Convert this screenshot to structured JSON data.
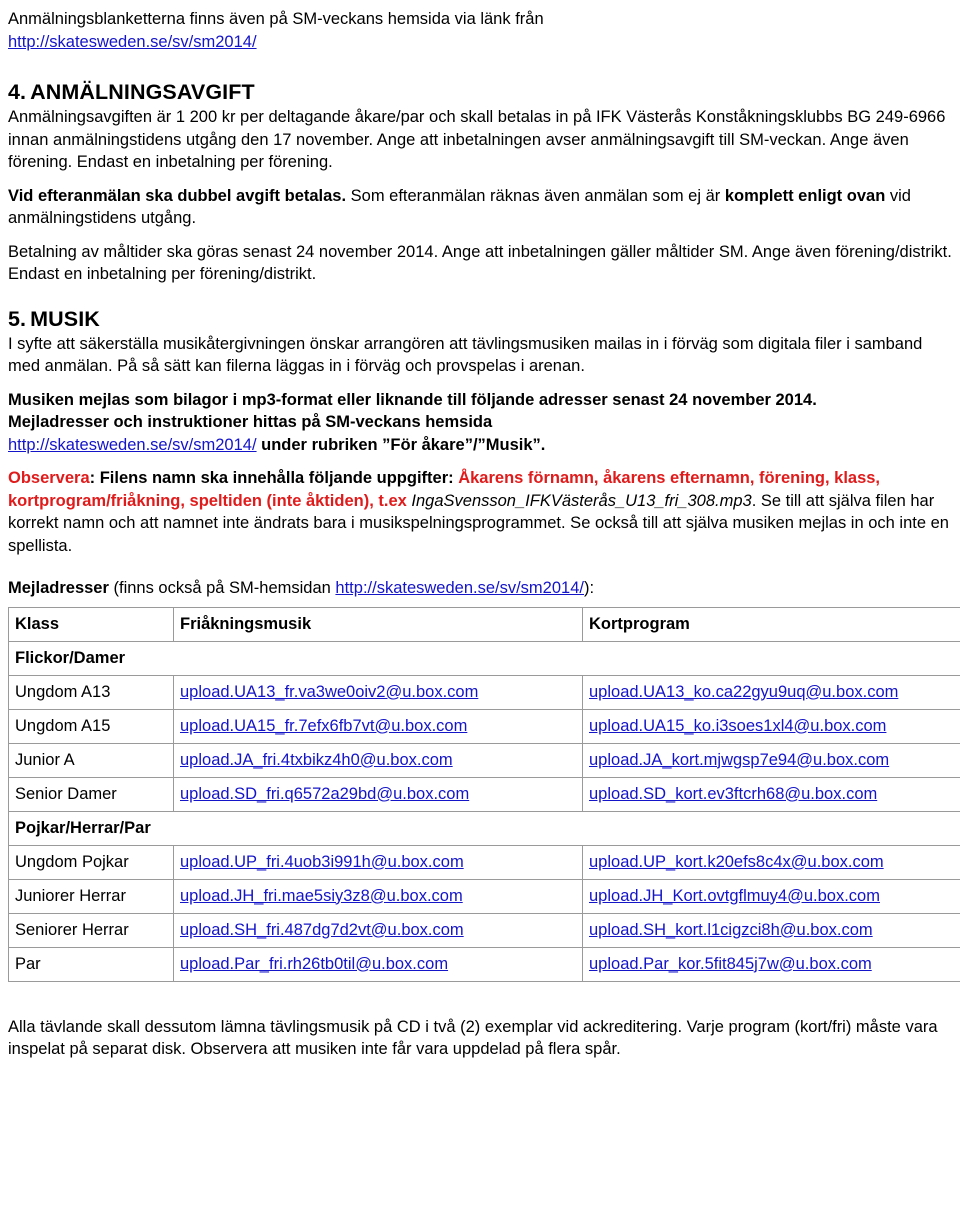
{
  "document": {
    "intro": {
      "line1": "Anmälningsblanketterna finns även på SM-veckans hemsida via länk från",
      "link": "http://skatesweden.se/sv/sm2014/"
    },
    "section4": {
      "number": "4.",
      "title": "ANMÄLNINGSAVGIFT",
      "p1": "Anmälningsavgiften är 1 200 kr per deltagande åkare/par och skall betalas in på IFK Västerås Konståkningsklubbs BG 249-6966 innan anmälningstidens utgång den 17 november. Ange att inbetalningen avser anmälningsavgift till SM-veckan. Ange även förening. Endast en inbetalning per förening.",
      "p2_bold1": "Vid efteranmälan ska dubbel avgift betalas.",
      "p2_mid": " Som efteranmälan räknas även anmälan som ej är ",
      "p2_bold2": "komplett enligt ovan",
      "p2_end": " vid anmälningstidens utgång.",
      "p3": "Betalning av måltider ska göras senast 24 november 2014. Ange att inbetalningen gäller måltider SM. Ange även förening/distrikt. Endast en inbetalning per förening/distrikt."
    },
    "section5": {
      "number": "5.",
      "title": "MUSIK",
      "p1": "I syfte att säkerställa musikåtergivningen önskar arrangören att tävlingsmusiken mailas in i förväg som digitala filer i samband med anmälan. På så sätt kan filerna läggas in i förväg och provspelas i arenan.",
      "p2_bold": "Musiken mejlas som bilagor i mp3-format eller liknande till följande adresser senast 24 november 2014.",
      "p3_bold": "Mejladresser och instruktioner hittas på SM-veckans hemsida",
      "p3_link": "http://skatesweden.se/sv/sm2014/",
      "p3_after_bold": " under rubriken ”För åkare”/”Musik”.",
      "observera_label": "Observera",
      "observera_black1": ": Filens namn ska innehålla följande uppgifter: ",
      "observera_red": "Åkarens förnamn, åkarens efternamn, förening, klass, kortprogram/friåkning, speltiden (inte åktiden), t.ex",
      "observera_italic": "IngaSvensson_IFKVästerås_U13_fri_308.mp3",
      "observera_black2": ". Se till att själva filen har korrekt namn och att namnet inte ändrats bara i musikspelningsprogrammet. Se också till att själva musiken mejlas in och inte en spellista."
    },
    "mail_note": {
      "bold": "Mejladresser",
      "mid": " (finns också på SM-hemsidan ",
      "link": "http://skatesweden.se/sv/sm2014/",
      "end": "):"
    },
    "table": {
      "headers": [
        "Klass",
        "Friåkningsmusik",
        "Kortprogram"
      ],
      "rows": [
        {
          "type": "group",
          "label": "Flickor/Damer"
        },
        {
          "type": "data",
          "klass": "Ungdom A13",
          "fri": "upload.UA13_fr.va3we0oiv2@u.box.com",
          "kort": "upload.UA13_ko.ca22gyu9uq@u.box.com"
        },
        {
          "type": "data",
          "klass": "Ungdom A15",
          "fri": "upload.UA15_fr.7efx6fb7vt@u.box.com",
          "kort": "upload.UA15_ko.i3soes1xl4@u.box.com"
        },
        {
          "type": "data",
          "klass": "Junior A",
          "fri": "upload.JA_fri.4txbikz4h0@u.box.com",
          "kort": "upload.JA_kort.mjwgsp7e94@u.box.com"
        },
        {
          "type": "data",
          "klass": "Senior Damer",
          "fri": "upload.SD_fri.q6572a29bd@u.box.com",
          "kort": "upload.SD_kort.ev3ftcrh68@u.box.com"
        },
        {
          "type": "group",
          "label": "Pojkar/Herrar/Par"
        },
        {
          "type": "data",
          "klass": "Ungdom Pojkar",
          "fri": "upload.UP_fri.4uob3i991h@u.box.com",
          "kort": "upload.UP_kort.k20efs8c4x@u.box.com"
        },
        {
          "type": "data",
          "klass": "Juniorer Herrar",
          "fri": "upload.JH_fri.mae5siy3z8@u.box.com",
          "kort": "upload.JH_Kort.ovtgflmuy4@u.box.com"
        },
        {
          "type": "data",
          "klass": "Seniorer Herrar",
          "fri": "upload.SH_fri.487dg7d2vt@u.box.com",
          "kort": "upload.SH_kort.l1cigzci8h@u.box.com"
        },
        {
          "type": "data",
          "klass": "Par",
          "fri": "upload.Par_fri.rh26tb0til@u.box.com",
          "kort": "upload.Par_kor.5fit845j7w@u.box.com"
        }
      ]
    },
    "footer": {
      "p1": "Alla tävlande skall dessutom lämna tävlingsmusik på CD i två (2) exemplar vid ackreditering. Varje program (kort/fri) måste vara inspelat på separat disk. Observera att musiken inte får vara uppdelad på flera spår."
    },
    "colors": {
      "link": "#1414c8",
      "accent_red": "#e01b1b",
      "text": "#000000",
      "table_border": "#9a9a9a"
    }
  }
}
